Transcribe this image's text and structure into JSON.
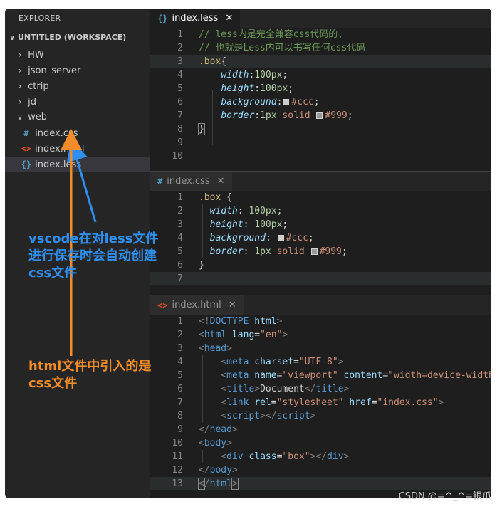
{
  "explorer": {
    "title": "EXPLORER",
    "workspace": "UNTITLED (WORKSPACE)",
    "items": [
      {
        "label": "HW",
        "type": "folder",
        "expanded": false
      },
      {
        "label": "json_server",
        "type": "folder",
        "expanded": false
      },
      {
        "label": "ctrip",
        "type": "folder",
        "expanded": false
      },
      {
        "label": "jd",
        "type": "folder",
        "expanded": false
      },
      {
        "label": "web",
        "type": "folder",
        "expanded": true
      },
      {
        "label": "index.css",
        "type": "file",
        "icon": "#",
        "icon_color": "#519aba"
      },
      {
        "label": "index.html",
        "type": "file",
        "icon": "<>",
        "icon_color": "#e44d26"
      },
      {
        "label": "index.less",
        "type": "file",
        "icon": "{}",
        "icon_color": "#519aba",
        "selected": true
      }
    ]
  },
  "editors": [
    {
      "tab": {
        "label": "index.less",
        "icon": "{}",
        "icon_color": "#519aba",
        "active": true,
        "close": "✕"
      },
      "line_numbers": [
        "1",
        "2",
        "3",
        "4",
        "5",
        "6",
        "7",
        "8",
        "9",
        "10"
      ]
    },
    {
      "tab": {
        "label": "index.css",
        "icon": "#",
        "icon_color": "#519aba",
        "active": false,
        "close": "✕"
      },
      "line_numbers": [
        "1",
        "2",
        "3",
        "4",
        "5",
        "6",
        "7"
      ]
    },
    {
      "tab": {
        "label": "index.html",
        "icon": "<>",
        "icon_color": "#e44d26",
        "active": false,
        "close": "✕"
      },
      "line_numbers": [
        "1",
        "2",
        "3",
        "4",
        "5",
        "6",
        "7",
        "8",
        "9",
        "10",
        "11",
        "12",
        "13"
      ]
    }
  ],
  "annotations": {
    "blue": [
      "vscode在对less文件",
      "进行保存时会自动创建",
      "css文件"
    ],
    "orange": [
      "html文件中引入的是",
      "css文件"
    ]
  },
  "watermark": "CSDN @=^_^=银爪"
}
